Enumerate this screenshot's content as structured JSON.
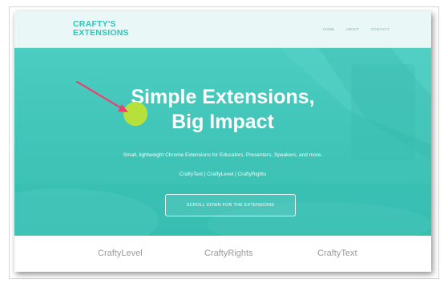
{
  "nav": {
    "logo_line1": "CRAFTY'S",
    "logo_line2": "EXTENSIONS",
    "links": [
      "HOME",
      "ABOUT",
      "CONTACT"
    ]
  },
  "hero": {
    "title_line1": "Simple Extensions,",
    "title_line2": "Big Impact",
    "subtitle": "Small, lightweight Chrome Extensions for Educators, Presenters, Speakers, and more.",
    "product_links": "CraftyText | CraftyLevel | CraftyRights",
    "cta_label": "SCROLL DOWN FOR THE EXTENSIONS"
  },
  "products": [
    "CraftyLevel",
    "CraftyRights",
    "CraftyText"
  ],
  "colors": {
    "brand_teal": "#2ec6b8",
    "hero_bg": "#42c6b9",
    "highlight_dot": "#b6e13a",
    "arrow": "#ef3f6f"
  }
}
